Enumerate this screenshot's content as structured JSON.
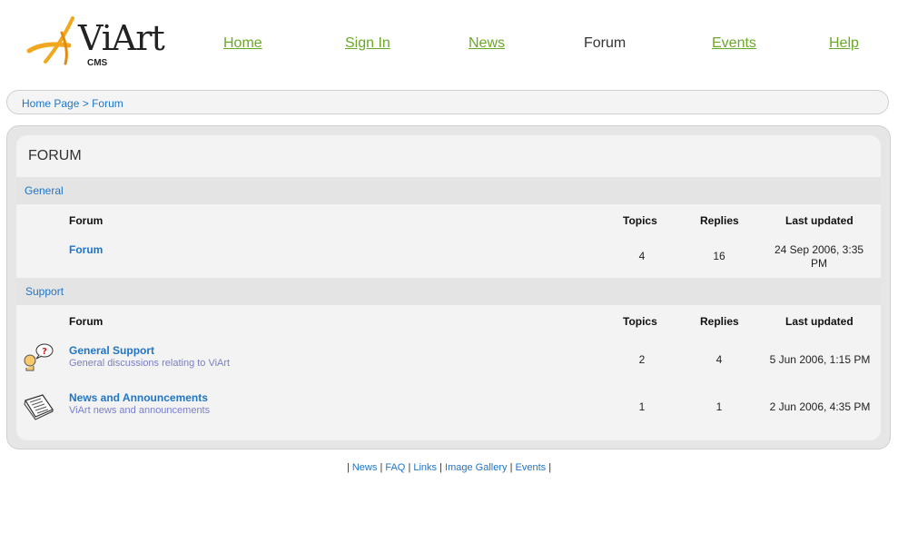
{
  "logo": {
    "name": "ViArt",
    "sub": "CMS"
  },
  "nav": {
    "home": "Home",
    "signin": "Sign In",
    "news": "News",
    "forum": "Forum",
    "events": "Events",
    "help": "Help"
  },
  "breadcrumb": {
    "home": "Home Page",
    "sep": " > ",
    "current": "Forum"
  },
  "forum": {
    "title": "FORUM",
    "columns": {
      "forum": "Forum",
      "topics": "Topics",
      "replies": "Replies",
      "last": "Last updated"
    },
    "categories": [
      {
        "name": "General",
        "forums": [
          {
            "name": "Forum",
            "desc": "",
            "topics": "4",
            "replies": "16",
            "last": "24 Sep 2006, 3:35 PM"
          }
        ]
      },
      {
        "name": "Support",
        "forums": [
          {
            "name": "General Support",
            "desc": "General discussions relating to ViArt",
            "topics": "2",
            "replies": "4",
            "last": "5 Jun 2006, 1:15 PM",
            "icon": "question-person-icon"
          },
          {
            "name": "News and Announcements",
            "desc": "ViArt news and announcements",
            "topics": "1",
            "replies": "1",
            "last": "2 Jun 2006, 4:35 PM",
            "icon": "newspaper-icon"
          }
        ]
      }
    ]
  },
  "footer": {
    "pipe": "|",
    "links": [
      "News",
      "FAQ",
      "Links",
      "Image Gallery",
      "Events"
    ]
  },
  "colors": {
    "link_green": "#6aa82a",
    "link_blue": "#1f75c7",
    "desc": "#7a7fc9",
    "logo_orange": "#f2a81e"
  }
}
